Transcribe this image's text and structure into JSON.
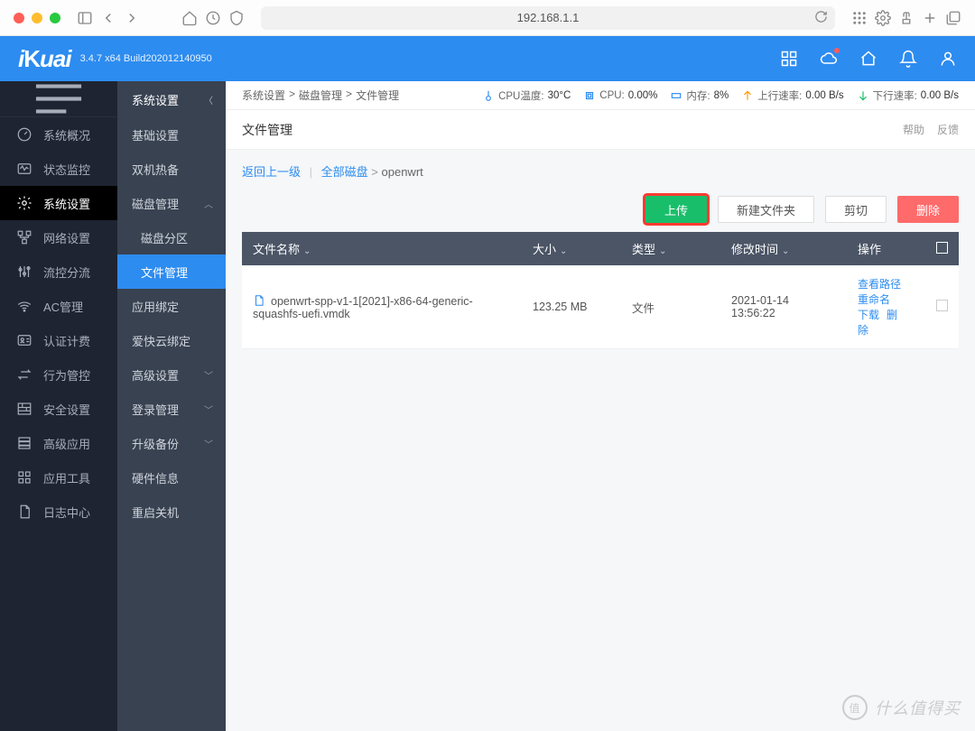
{
  "browser": {
    "url": "192.168.1.1"
  },
  "header": {
    "logo": "iKuai",
    "version": "3.4.7 x64 Build202012140950"
  },
  "sidebar1": {
    "items": [
      {
        "label": "系统概况"
      },
      {
        "label": "状态监控"
      },
      {
        "label": "系统设置"
      },
      {
        "label": "网络设置"
      },
      {
        "label": "流控分流"
      },
      {
        "label": "AC管理"
      },
      {
        "label": "认证计费"
      },
      {
        "label": "行为管控"
      },
      {
        "label": "安全设置"
      },
      {
        "label": "高级应用"
      },
      {
        "label": "应用工具"
      },
      {
        "label": "日志中心"
      }
    ]
  },
  "sidebar2": {
    "title": "系统设置",
    "items": [
      {
        "label": "基础设置"
      },
      {
        "label": "双机热备"
      },
      {
        "label": "磁盘管理",
        "expandable": true
      },
      {
        "label": "磁盘分区",
        "indent": true
      },
      {
        "label": "文件管理",
        "indent": true,
        "active": true
      },
      {
        "label": "应用绑定"
      },
      {
        "label": "爱快云绑定"
      },
      {
        "label": "高级设置",
        "expandable": true
      },
      {
        "label": "登录管理",
        "expandable": true
      },
      {
        "label": "升级备份",
        "expandable": true
      },
      {
        "label": "硬件信息"
      },
      {
        "label": "重启关机"
      }
    ]
  },
  "crumbs": [
    "系统设置",
    "磁盘管理",
    "文件管理"
  ],
  "stats": {
    "cpu_temp_label": "CPU温度:",
    "cpu_temp": "30°C",
    "cpu_label": "CPU:",
    "cpu": "0.00%",
    "mem_label": "内存:",
    "mem": "8%",
    "up_label": "上行速率:",
    "up": "0.00 B/s",
    "down_label": "下行速率:",
    "down": "0.00 B/s"
  },
  "page_title": "文件管理",
  "help": "帮助",
  "feedback": "反馈",
  "path": {
    "back": "返回上一级",
    "all": "全部磁盘",
    "current": "openwrt"
  },
  "buttons": {
    "upload": "上传",
    "newfolder": "新建文件夹",
    "cut": "剪切",
    "delete": "删除"
  },
  "table": {
    "cols": [
      "文件名称",
      "大小",
      "类型",
      "修改时间",
      "操作"
    ],
    "rows": [
      {
        "name": "openwrt-spp-v1-1[2021]-x86-64-generic-squashfs-uefi.vmdk",
        "size": "123.25 MB",
        "type": "文件",
        "mtime": "2021-01-14 13:56:22",
        "ops": [
          "查看路径",
          "重命名",
          "下载",
          "删除"
        ]
      }
    ]
  },
  "watermark": "什么值得买"
}
